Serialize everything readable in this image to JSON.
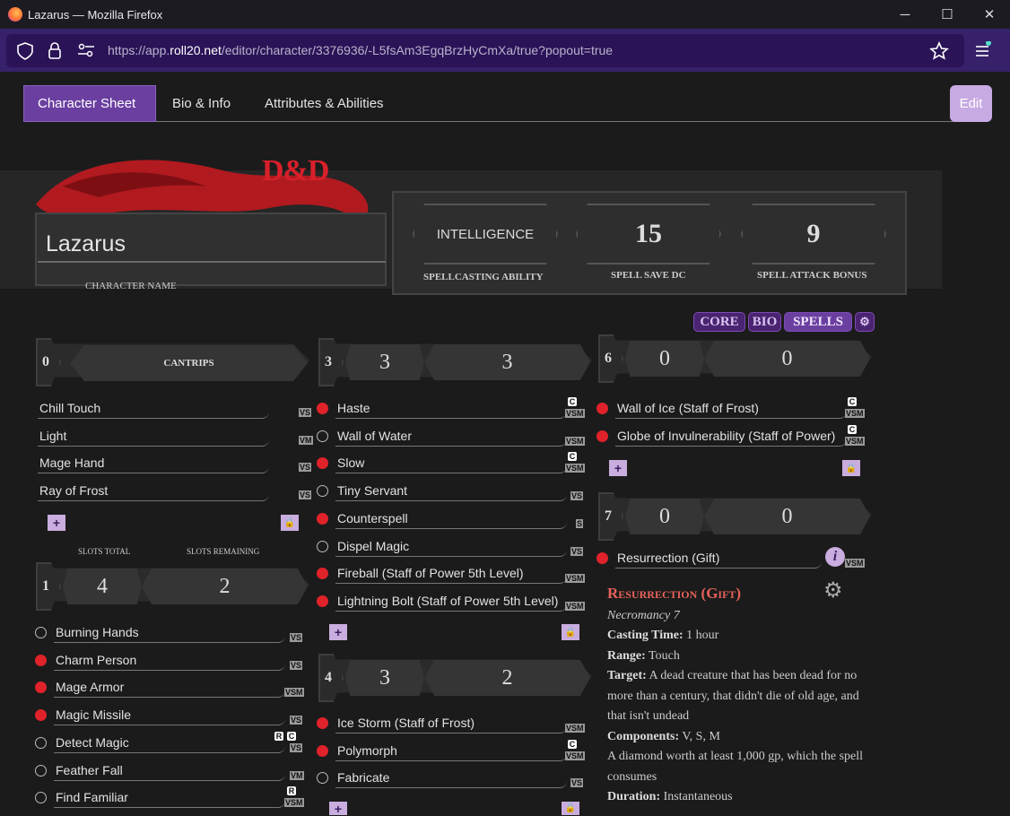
{
  "window": {
    "title": "Lazarus — Mozilla Firefox",
    "min": "─",
    "max": "☐",
    "close": "✕"
  },
  "browser": {
    "url_pre": "https://app.",
    "url_host": "roll20.net",
    "url_post": "/editor/character/3376936/-L5fsAm3EgqBrzHyCmXa/true?popout=true"
  },
  "tabs": {
    "sheet": "Character Sheet",
    "bio": "Bio & Info",
    "attrs": "Attributes & Abilities",
    "edit": "Edit"
  },
  "header": {
    "logo": "D&D",
    "name": "Lazarus",
    "name_label": "CHARACTER NAME",
    "ability": "INTELLIGENCE",
    "ability_label": "SPELLCASTING ABILITY",
    "dc": "15",
    "dc_label": "SPELL SAVE DC",
    "attack": "9",
    "attack_label": "SPELL ATTACK BONUS"
  },
  "nav": {
    "core": "CORE",
    "bio": "BIO",
    "spells": "SPELLS"
  },
  "cantrips": {
    "level": "0",
    "label": "CANTRIPS",
    "items": [
      {
        "name": "Chill Touch",
        "tag": "VS"
      },
      {
        "name": "Light",
        "tag": "VM"
      },
      {
        "name": "Mage Hand",
        "tag": "VS"
      },
      {
        "name": "Ray of Frost",
        "tag": "VS"
      }
    ]
  },
  "slot_labels": {
    "total": "SLOTS TOTAL",
    "remaining": "SLOTS REMAINING"
  },
  "lvl1": {
    "level": "1",
    "total": "4",
    "remaining": "2",
    "items": [
      {
        "name": "Burning Hands",
        "tag": "VS",
        "prepared": false
      },
      {
        "name": "Charm Person",
        "tag": "VS",
        "prepared": true
      },
      {
        "name": "Mage Armor",
        "tag": "VSM",
        "prepared": true
      },
      {
        "name": "Magic Missile",
        "tag": "VS",
        "prepared": true
      },
      {
        "name": "Detect Magic",
        "tag": "VS",
        "prepared": false,
        "r": "R",
        "c": "C"
      },
      {
        "name": "Feather Fall",
        "tag": "VM",
        "prepared": false
      },
      {
        "name": "Find Familiar",
        "tag": "VSM",
        "prepared": false,
        "r": "R"
      }
    ]
  },
  "lvl3": {
    "level": "3",
    "total": "3",
    "remaining": "3",
    "items": [
      {
        "name": "Haste",
        "tag": "VSM",
        "prepared": true,
        "c": "C"
      },
      {
        "name": "Wall of Water",
        "tag": "VSM",
        "prepared": false
      },
      {
        "name": "Slow",
        "tag": "VSM",
        "prepared": true,
        "c": "C"
      },
      {
        "name": "Tiny Servant",
        "tag": "VS",
        "prepared": false
      },
      {
        "name": "Counterspell",
        "tag": "S",
        "prepared": true
      },
      {
        "name": "Dispel Magic",
        "tag": "VS",
        "prepared": false
      },
      {
        "name": "Fireball (Staff of Power 5th Level)",
        "tag": "VSM",
        "prepared": true
      },
      {
        "name": "Lightning Bolt (Staff of Power 5th Level)",
        "tag": "VSM",
        "prepared": true
      }
    ]
  },
  "lvl4": {
    "level": "4",
    "total": "3",
    "remaining": "2",
    "items": [
      {
        "name": "Ice Storm (Staff of Frost)",
        "tag": "VSM",
        "prepared": true
      },
      {
        "name": "Polymorph",
        "tag": "VSM",
        "prepared": true,
        "c": "C"
      },
      {
        "name": "Fabricate",
        "tag": "VS",
        "prepared": false
      }
    ]
  },
  "lvl6": {
    "level": "6",
    "total": "0",
    "remaining": "0",
    "items": [
      {
        "name": "Wall of Ice (Staff of Frost)",
        "tag": "VSM",
        "prepared": true,
        "c": "C"
      },
      {
        "name": "Globe of Invulnerability (Staff of Power)",
        "tag": "VSM",
        "prepared": true,
        "c": "C"
      }
    ]
  },
  "lvl7": {
    "level": "7",
    "total": "0",
    "remaining": "0",
    "items": [
      {
        "name": "Resurrection (Gift)",
        "tag": "VSM",
        "prepared": true
      }
    ]
  },
  "buttons": {
    "add": "+",
    "lock": "🔒",
    "info": "i",
    "gear": "⚙"
  },
  "detail": {
    "title": "Resurrection (Gift)",
    "school": "Necromancy 7",
    "casting_label": "Casting Time:",
    "casting": " 1 hour",
    "range_label": "Range:",
    "range": " Touch",
    "target_label": "Target:",
    "target": " A dead creature that has been dead for no more than a century, that didn't die of old age, and that isn't undead",
    "components_label": "Components:",
    "components": " V, S, M",
    "material": "A diamond worth at least 1,000 gp, which the spell consumes",
    "duration_label": "Duration:",
    "duration": "  Instantaneous"
  },
  "colors": {
    "accent": "#6b3fa0",
    "dot": "#e0222a",
    "title": "#e8625a"
  }
}
